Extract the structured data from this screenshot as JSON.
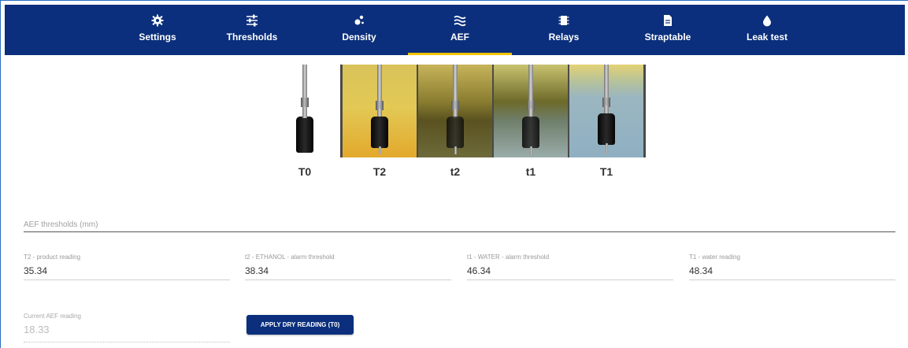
{
  "nav": {
    "tabs": [
      {
        "label": "Settings",
        "icon": "gear-icon"
      },
      {
        "label": "Thresholds",
        "icon": "sliders-icon"
      },
      {
        "label": "Density",
        "icon": "density-icon"
      },
      {
        "label": "AEF",
        "icon": "waves-icon",
        "active": true
      },
      {
        "label": "Relays",
        "icon": "relay-icon"
      },
      {
        "label": "Straptable",
        "icon": "document-icon"
      },
      {
        "label": "Leak test",
        "icon": "drop-icon"
      }
    ]
  },
  "probe": {
    "panels": [
      {
        "label": "T0"
      },
      {
        "label": "T2"
      },
      {
        "label": "t2"
      },
      {
        "label": "t1"
      },
      {
        "label": "T1"
      }
    ]
  },
  "aef": {
    "section_title": "AEF thresholds (mm)",
    "fields": [
      {
        "label": "T2 - product reading",
        "value": "35.34"
      },
      {
        "label": "t2 - ETHANOL - alarm threshold",
        "value": "38.34"
      },
      {
        "label": "t1 - WATER - alarm threshold",
        "value": "46.34"
      },
      {
        "label": "T1 - water reading",
        "value": "48.34"
      }
    ],
    "current": {
      "label": "Current AEF reading",
      "value": "18.33"
    },
    "apply_button": "APPLY DRY READING (T0)"
  },
  "colors": {
    "navbar": "#0b2f7c",
    "active_underline": "#f2c400"
  }
}
